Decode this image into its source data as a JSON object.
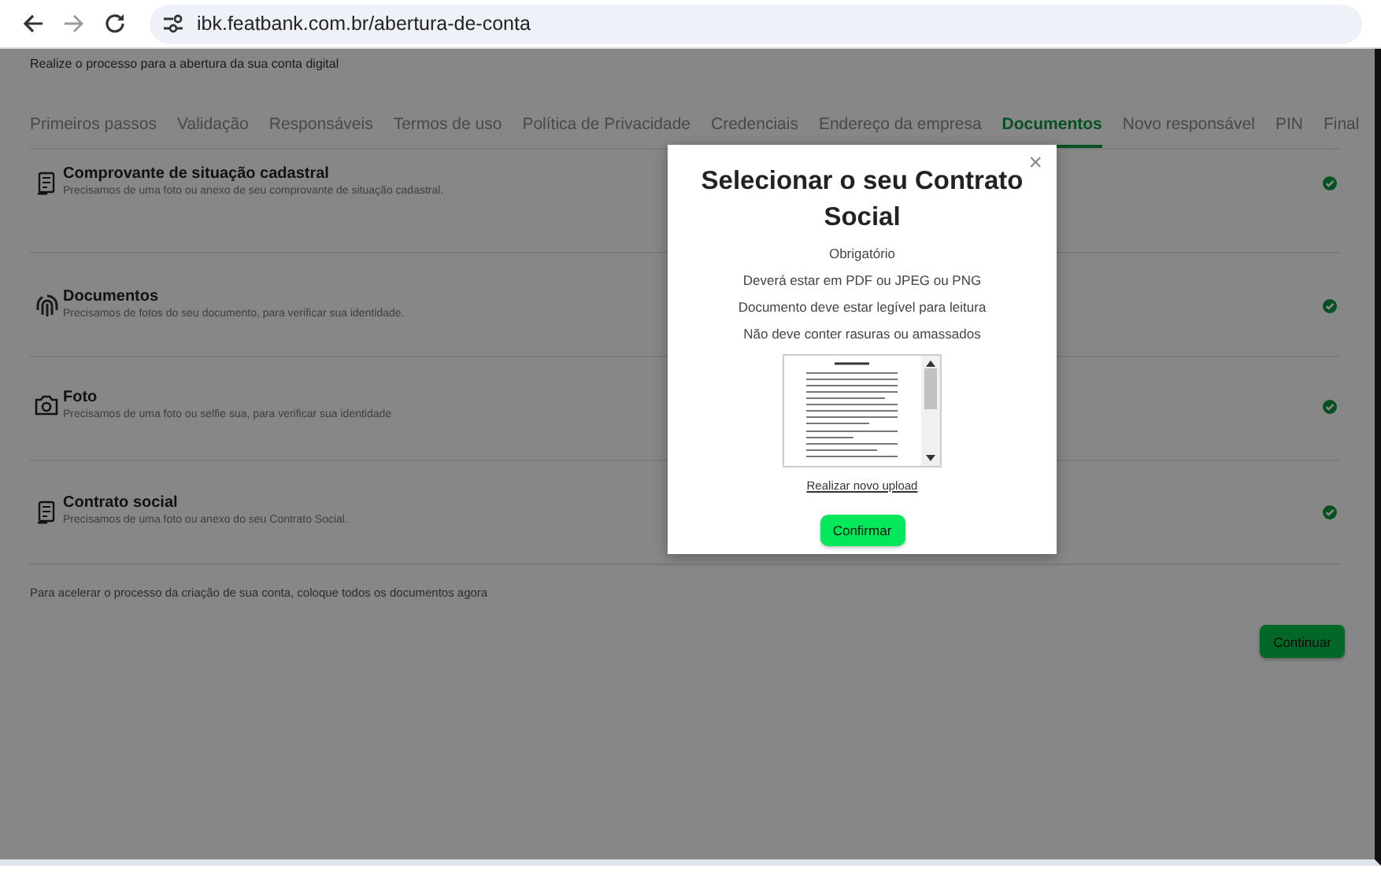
{
  "browser": {
    "url": "ibk.featbank.com.br/abertura-de-conta"
  },
  "page": {
    "subtitle": "Realize o processo para a abertura da sua conta digital",
    "tabs": [
      {
        "label": "Primeiros passos",
        "selected": false
      },
      {
        "label": "Validação",
        "selected": false
      },
      {
        "label": "Responsáveis",
        "selected": false
      },
      {
        "label": "Termos de uso",
        "selected": false
      },
      {
        "label": "Política de Privacidade",
        "selected": false
      },
      {
        "label": "Credenciais",
        "selected": false
      },
      {
        "label": "Endereço da empresa",
        "selected": false
      },
      {
        "label": "Documentos",
        "selected": true
      },
      {
        "label": "Novo responsável",
        "selected": false
      },
      {
        "label": "PIN",
        "selected": false
      },
      {
        "label": "Final",
        "selected": false
      }
    ],
    "documents": [
      {
        "kind": "file",
        "title": "Comprovante de situação cadastral",
        "description": "Precisamos de uma foto ou anexo de seu comprovante de situação cadastral.",
        "done": true
      },
      {
        "kind": "fingerprint",
        "title": "Documentos",
        "description": "Precisamos de fotos do seu documento, para verificar sua identidade.",
        "done": true
      },
      {
        "kind": "camera",
        "title": "Foto",
        "description": "Precisamos de uma foto ou selfie sua, para verificar sua identidade",
        "done": true
      },
      {
        "kind": "file",
        "title": "Contrato social",
        "description": "Precisamos de uma foto ou anexo do seu Contrato Social.",
        "done": true
      }
    ],
    "hint": "Para acelerar o processo da criação de sua conta, coloque todos os documentos agora",
    "continue_button": "Continuar"
  },
  "modal": {
    "close": "×",
    "title": "Selecionar o seu Contrato Social",
    "requirements": [
      "Obrigatório",
      "Deverá estar em PDF ou JPEG ou PNG",
      "Documento deve estar legível para leitura",
      "Não deve conter rasuras ou amassados"
    ],
    "reupload_link": "Realizar novo upload",
    "confirm_button": "Confirmar"
  }
}
